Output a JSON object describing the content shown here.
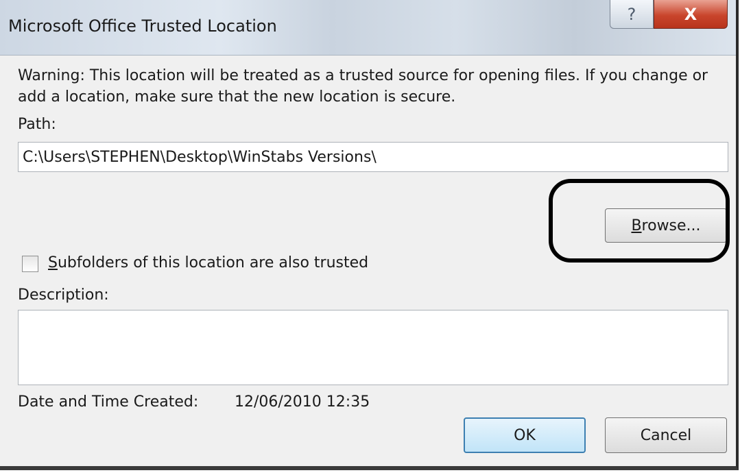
{
  "window": {
    "title": "Microsoft Office Trusted Location",
    "help_label": "?",
    "close_label": "X"
  },
  "warning": "Warning: This location will be treated as a trusted source for opening files. If you change or add a location, make sure that the new location is secure.",
  "path": {
    "label": "Path:",
    "value": "C:\\Users\\STEPHEN\\Desktop\\WinStabs Versions\\"
  },
  "browse": {
    "mnemonic": "B",
    "rest": "rowse..."
  },
  "subfolders": {
    "mnemonic": "S",
    "rest": "ubfolders of this location are also trusted",
    "checked": false
  },
  "description": {
    "label": "Description:",
    "value": ""
  },
  "created": {
    "label": "Date and Time Created:",
    "value": "12/06/2010 12:35"
  },
  "buttons": {
    "ok": "OK",
    "cancel": "Cancel"
  },
  "colors": {
    "annotation_outline": "#000000",
    "close_button": "#c9452c",
    "default_button_border": "#3c7fb1"
  }
}
